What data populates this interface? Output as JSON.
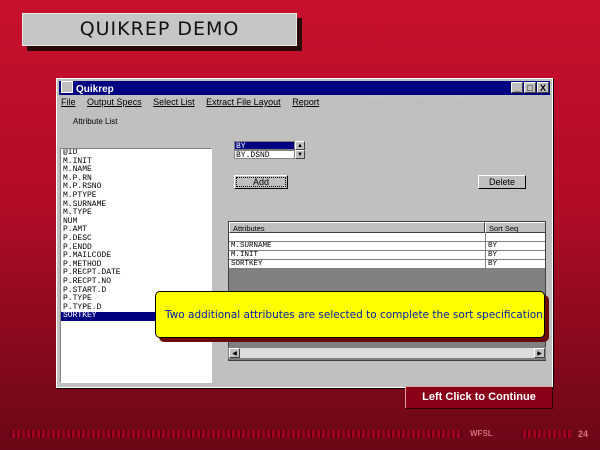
{
  "banner": {
    "title": "QUIKREP  DEMO"
  },
  "window": {
    "title": "Quikrep",
    "buttons": [
      "_",
      "□",
      "X"
    ],
    "menu": [
      "File",
      "Output Specs",
      "Select List",
      "Extract File Layout",
      "Report"
    ],
    "menu_faint": "·····································",
    "attr_label": "Attribute List",
    "attributes": [
      "@ID",
      "M.INIT",
      "M.NAME",
      "M.P.RN",
      "M.P.RSNO",
      "M.PTYPE",
      "M.SURNAME",
      "M.TYPE",
      "NUM",
      "P.AMT",
      "P.DESC",
      "P.ENDD",
      "P.MAILCODE",
      "P.METHOD",
      "P.RECPT.DATE",
      "P.RECPT.NO",
      "P.START.D",
      "P.TYPE",
      "P.TYPE.D",
      "SORTKEY"
    ],
    "selected_attribute": "SORTKEY",
    "order_options": [
      "BY",
      "BY.DSND"
    ],
    "selected_order": "BY",
    "add_label": "Add",
    "delete_label": "Delete",
    "table": {
      "headers": [
        "Attributes",
        "Sort Seq"
      ],
      "rows": [
        [
          "",
          ""
        ],
        [
          "M.SURNAME",
          "BY"
        ],
        [
          "M.INIT",
          "BY"
        ],
        [
          "SORTKEY",
          "BY"
        ]
      ]
    }
  },
  "callout": {
    "text": "Two additional attributes are selected to complete the sort specification."
  },
  "continue": {
    "label": "Left Click to Continue"
  },
  "footer": {
    "brand": "WFSL",
    "page": "24"
  }
}
